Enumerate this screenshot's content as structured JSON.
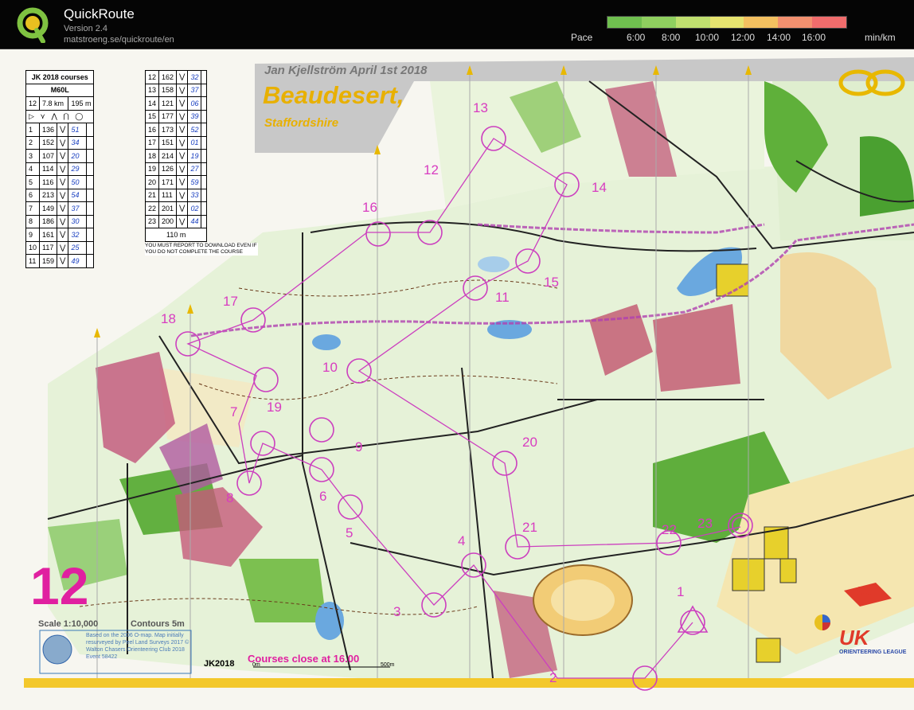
{
  "app": {
    "title": "QuickRoute",
    "version": "Version 2.4",
    "url": "matstroeng.se/quickroute/en"
  },
  "pace": {
    "label": "Pace",
    "ticks": [
      "6:00",
      "8:00",
      "10:00",
      "12:00",
      "14:00",
      "16:00"
    ],
    "unit": "min/km",
    "gradient": [
      "#6fbf4f",
      "#8fcf5f",
      "#bfdf6f",
      "#e6e36f",
      "#f3c060",
      "#f2906f",
      "#f06c6c"
    ]
  },
  "map": {
    "event_title": "Jan Kjellström April 1st 2018",
    "event_name": "Beaudesert,",
    "event_location": "Staffordshire",
    "course_number": "12",
    "scale": "Scale 1:10,000",
    "contours": "Contours 5m",
    "credits": "Based on the 2006 O-map. Map initially resurveyed by Peel Land Surveys 2017 © Walton Chasers Orienteering Club 2018 Event 58422",
    "courses_close": "Courses close at 16.00",
    "jk_logo": "JK2018",
    "iof_logo": "IOF",
    "uk_logo": "UK",
    "uk_sub": "ORIENTEERING LEAGUE",
    "scale_bar_0": "0m",
    "scale_bar_500": "500m",
    "control_numbers": [
      "1",
      "2",
      "3",
      "4",
      "5",
      "6",
      "7",
      "8",
      "9",
      "10",
      "11",
      "12",
      "13",
      "14",
      "15",
      "16",
      "17",
      "18",
      "19",
      "20",
      "21",
      "22",
      "23"
    ]
  },
  "descriptions": {
    "header": "JK 2018 courses",
    "course_name": "M60L",
    "course_no": "12",
    "length": "7.8 km",
    "climb": "195 m",
    "left_rows": [
      {
        "n": "1",
        "code": "136",
        "split": "51"
      },
      {
        "n": "2",
        "code": "152",
        "split": "34"
      },
      {
        "n": "3",
        "code": "107",
        "split": "20"
      },
      {
        "n": "4",
        "code": "114",
        "split": "29"
      },
      {
        "n": "5",
        "code": "116",
        "split": "50"
      },
      {
        "n": "6",
        "code": "213",
        "split": "54"
      },
      {
        "n": "7",
        "code": "149",
        "split": "37"
      },
      {
        "n": "8",
        "code": "186",
        "split": "30"
      },
      {
        "n": "9",
        "code": "161",
        "split": "32"
      },
      {
        "n": "10",
        "code": "117",
        "split": "25"
      },
      {
        "n": "11",
        "code": "159",
        "split": "49"
      }
    ],
    "right_rows": [
      {
        "n": "12",
        "code": "162",
        "split": "32"
      },
      {
        "n": "13",
        "code": "158",
        "split": "37"
      },
      {
        "n": "14",
        "code": "121",
        "split": "06"
      },
      {
        "n": "15",
        "code": "177",
        "split": "39"
      },
      {
        "n": "16",
        "code": "173",
        "split": "52"
      },
      {
        "n": "17",
        "code": "151",
        "split": "01"
      },
      {
        "n": "18",
        "code": "214",
        "split": "19"
      },
      {
        "n": "19",
        "code": "126",
        "split": "27"
      },
      {
        "n": "20",
        "code": "171",
        "split": "59"
      },
      {
        "n": "21",
        "code": "111",
        "split": "33"
      },
      {
        "n": "22",
        "code": "201",
        "split": "02"
      },
      {
        "n": "23",
        "code": "200",
        "split": "44"
      }
    ],
    "finish_row": "110 m",
    "note": "YOU MUST REPORT TO DOWNLOAD EVEN IF YOU DO NOT COMPLETE THE COURSE"
  }
}
